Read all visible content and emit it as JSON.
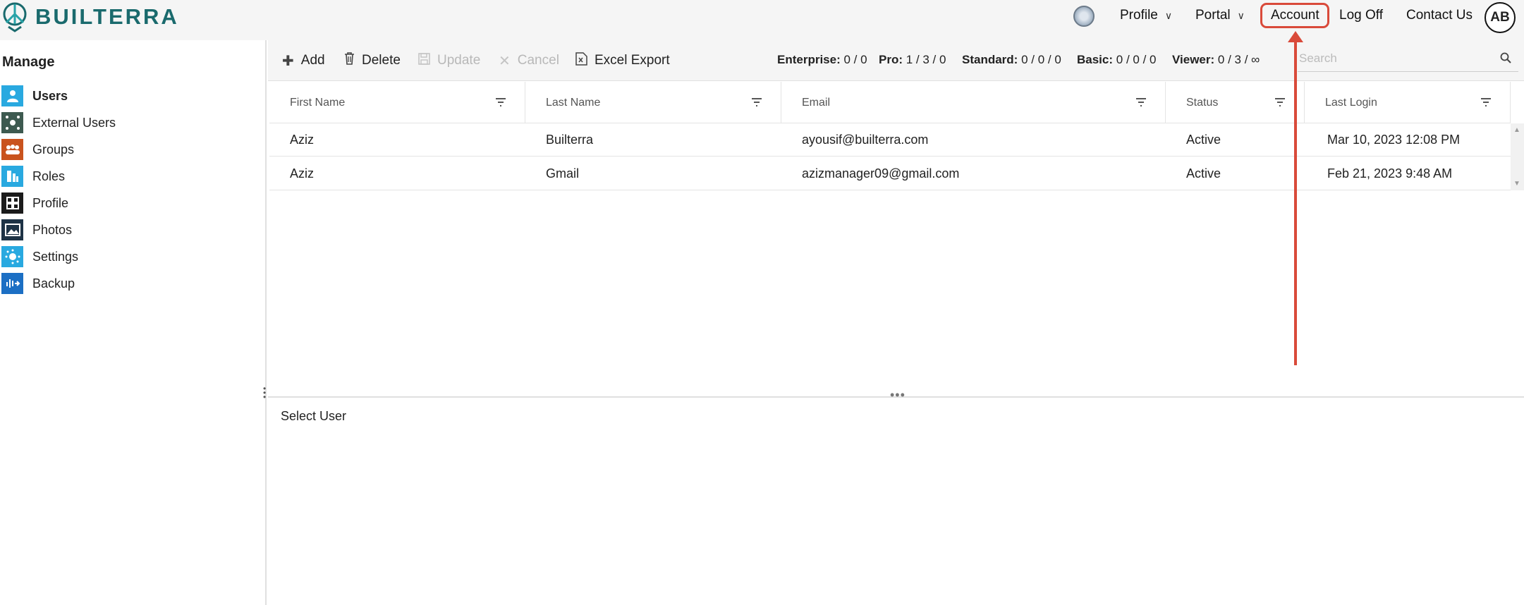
{
  "header": {
    "brand": "BUILTERRA",
    "nav": [
      {
        "label": "Profile",
        "has_caret": true
      },
      {
        "label": "Portal",
        "has_caret": true
      },
      {
        "label": "Account",
        "has_caret": false
      },
      {
        "label": "Log Off",
        "has_caret": false
      },
      {
        "label": "Contact Us",
        "has_caret": false
      }
    ],
    "caret": "∨",
    "avatar_initials": "AB",
    "highlight_color": "#d94a3a"
  },
  "sidebar": {
    "title": "Manage",
    "items": [
      {
        "label": "Users",
        "icon": "user-icon",
        "color": "#29a9e0",
        "active": true
      },
      {
        "label": "External Users",
        "icon": "external-users-icon",
        "color": "#3d5a50",
        "active": false
      },
      {
        "label": "Groups",
        "icon": "groups-icon",
        "color": "#c9531e",
        "active": false
      },
      {
        "label": "Roles",
        "icon": "roles-icon",
        "color": "#29a9e0",
        "active": false
      },
      {
        "label": "Profile",
        "icon": "profile-grid-icon",
        "color": "#1b1b1b",
        "active": false
      },
      {
        "label": "Photos",
        "icon": "photos-icon",
        "color": "#1e3346",
        "active": false
      },
      {
        "label": "Settings",
        "icon": "settings-icon",
        "color": "#29a9e0",
        "active": false
      },
      {
        "label": "Backup",
        "icon": "backup-icon",
        "color": "#1c6fc4",
        "active": false
      }
    ]
  },
  "toolbar": {
    "add": "Add",
    "delete": "Delete",
    "update": "Update",
    "cancel": "Cancel",
    "excel_export": "Excel Export"
  },
  "licenses": [
    {
      "name": "Enterprise:",
      "value": "0 / 0"
    },
    {
      "name": "Pro:",
      "value": "1 / 3 / 0"
    },
    {
      "name": "Standard:",
      "value": "0 / 0 / 0"
    },
    {
      "name": "Basic:",
      "value": "0 / 0 / 0"
    },
    {
      "name": "Viewer:",
      "value": "0 / 3 / ∞"
    }
  ],
  "search": {
    "placeholder": "Search"
  },
  "grid": {
    "columns": [
      "First Name",
      "Last Name",
      "Email",
      "Status",
      "Last Login"
    ],
    "rows": [
      [
        "Aziz",
        "Builterra",
        "ayousif@builterra.com",
        "Active",
        "Mar 10, 2023 12:08 PM"
      ],
      [
        "Aziz",
        "Gmail",
        "azizmanager09@gmail.com",
        "Active",
        "Feb 21, 2023 9:48 AM"
      ]
    ]
  },
  "detail": {
    "placeholder": "Select User"
  }
}
